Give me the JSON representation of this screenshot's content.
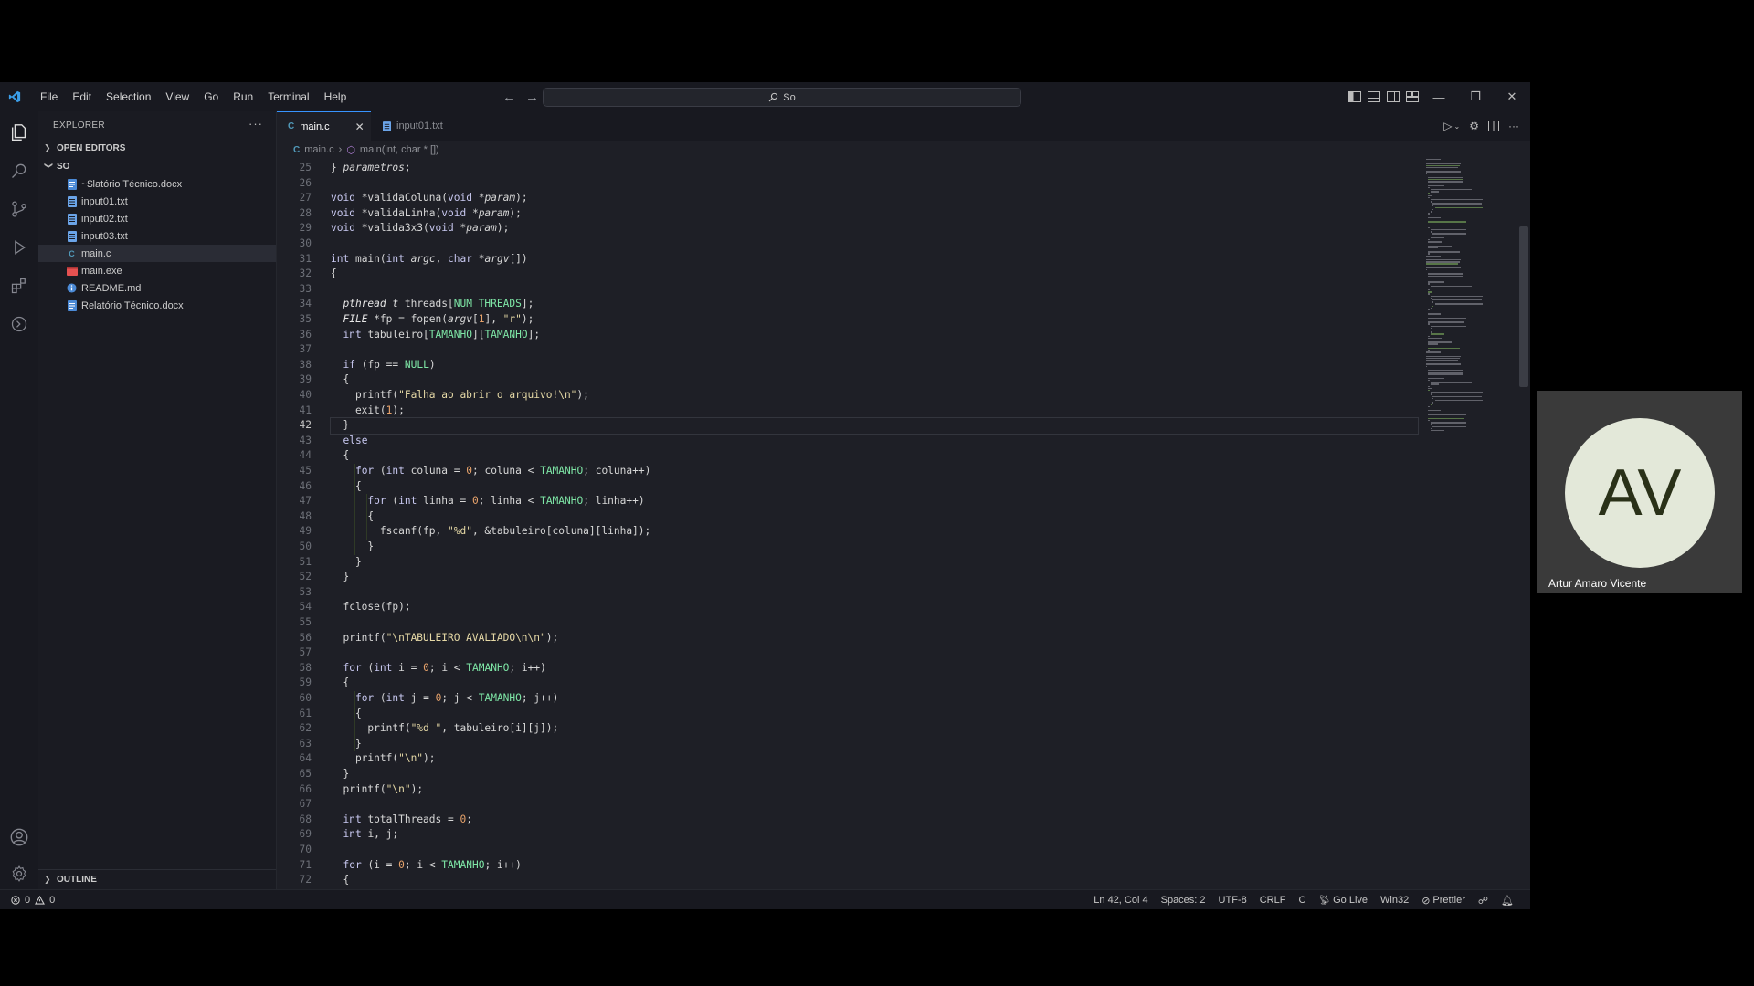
{
  "window": {
    "menu": [
      "File",
      "Edit",
      "Selection",
      "View",
      "Go",
      "Run",
      "Terminal",
      "Help"
    ],
    "search_text": "So",
    "window_controls": [
      "minimize-icon",
      "restore-icon",
      "close-icon"
    ]
  },
  "sidebar": {
    "title": "EXPLORER",
    "more": "···",
    "open_editors_label": "OPEN EDITORS",
    "folder_label": "SO",
    "files": [
      {
        "name": "~$latório Técnico.docx",
        "icon": "word-doc-icon",
        "color": "#4b8ad6"
      },
      {
        "name": "input01.txt",
        "icon": "text-file-icon",
        "color": "#6ba4e8"
      },
      {
        "name": "input02.txt",
        "icon": "text-file-icon",
        "color": "#6ba4e8"
      },
      {
        "name": "input03.txt",
        "icon": "text-file-icon",
        "color": "#6ba4e8"
      },
      {
        "name": "main.c",
        "icon": "c-file-icon",
        "color": "#519aba"
      },
      {
        "name": "main.exe",
        "icon": "exe-file-icon",
        "color": "#e55151"
      },
      {
        "name": "README.md",
        "icon": "info-icon",
        "color": "#4b8ad6"
      },
      {
        "name": "Relatório Técnico.docx",
        "icon": "word-doc-icon",
        "color": "#4b8ad6"
      }
    ],
    "outline_label": "OUTLINE"
  },
  "tabs": [
    {
      "label": "main.c",
      "active": true
    },
    {
      "label": "input01.txt",
      "active": false
    }
  ],
  "breadcrumb": {
    "file": "main.c",
    "symbol": "main(int, char * [])"
  },
  "editor": {
    "current_line": "42",
    "line_numbers": [
      "25",
      "26",
      "27",
      "28",
      "29",
      "30",
      "31",
      "32",
      "33",
      "34",
      "35",
      "36",
      "37",
      "38",
      "39",
      "40",
      "41",
      "42",
      "43",
      "44",
      "45",
      "46",
      "47",
      "48",
      "49",
      "50",
      "51",
      "52",
      "53",
      "54",
      "55",
      "56",
      "57",
      "58",
      "59",
      "60",
      "61",
      "62",
      "63",
      "64",
      "65",
      "66",
      "67",
      "68",
      "69",
      "70",
      "71",
      "72"
    ],
    "code": [
      "} parametros;",
      "",
      "void *validaColuna(void *param);",
      "void *validaLinha(void *param);",
      "void *valida3x3(void *param);",
      "",
      "int main(int argc, char *argv[])",
      "{",
      "",
      "  pthread_t threads[NUM_THREADS];",
      "  FILE *fp = fopen(argv[1], \"r\");",
      "  int tabuleiro[TAMANHO][TAMANHO];",
      "",
      "  if (fp == NULL)",
      "  {",
      "    printf(\"Falha ao abrir o arquivo!\\n\");",
      "    exit(1);",
      "  }",
      "  else",
      "  {",
      "    for (int coluna = 0; coluna < TAMANHO; coluna++)",
      "    {",
      "      for (int linha = 0; linha < TAMANHO; linha++)",
      "      {",
      "        fscanf(fp, \"%d\", &tabuleiro[coluna][linha]);",
      "      }",
      "    }",
      "  }",
      "",
      "  fclose(fp);",
      "",
      "  printf(\"\\nTABULEIRO AVALIADO\\n\\n\");",
      "",
      "  for (int i = 0; i < TAMANHO; i++)",
      "  {",
      "    for (int j = 0; j < TAMANHO; j++)",
      "    {",
      "      printf(\"%d \", tabuleiro[i][j]);",
      "    }",
      "    printf(\"\\n\");",
      "  }",
      "  printf(\"\\n\");",
      "",
      "  int totalThreads = 0;",
      "  int i, j;",
      "",
      "  for (i = 0; i < TAMANHO; i++)",
      "  {"
    ]
  },
  "status": {
    "errors": "0",
    "warnings": "0",
    "position": "Ln 42, Col 4",
    "spaces": "Spaces: 2",
    "encoding": "UTF-8",
    "eol": "CRLF",
    "language": "C",
    "go_live": "Go Live",
    "platform": "Win32",
    "prettier": "Prettier"
  },
  "participant": {
    "initials": "AV",
    "name": "Artur Amaro Vicente"
  }
}
